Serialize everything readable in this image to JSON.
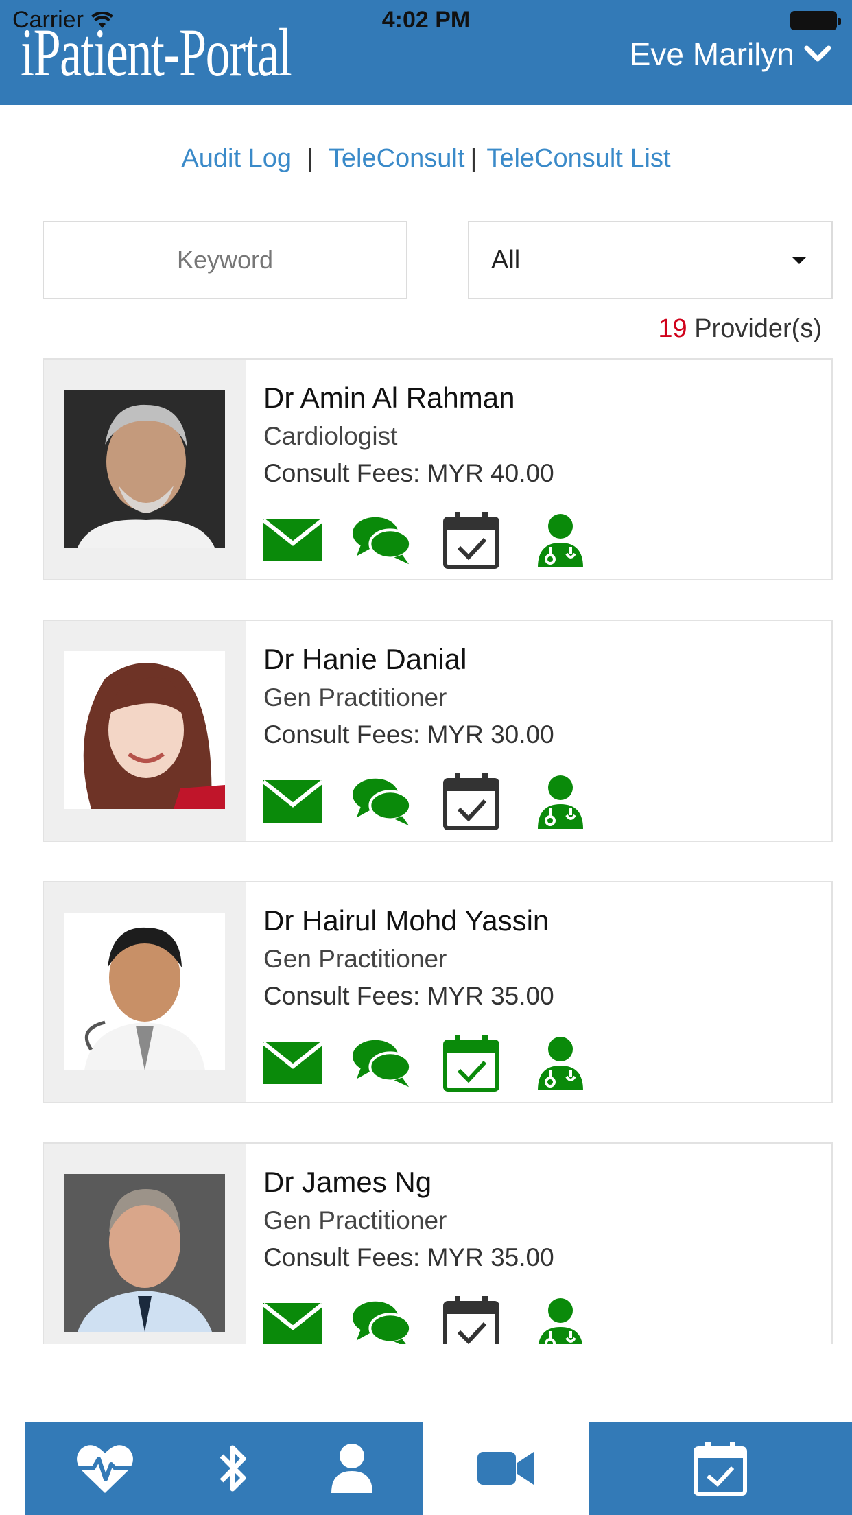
{
  "status_bar": {
    "carrier": "Carrier",
    "time": "4:02 PM"
  },
  "header": {
    "logo": "iPatient-Portal",
    "user_name": "Eve Marilyn"
  },
  "links": [
    {
      "label": "Audit Log"
    },
    {
      "label": "TeleConsult"
    },
    {
      "label": "TeleConsult List"
    }
  ],
  "search": {
    "placeholder": "Keyword"
  },
  "filter": {
    "selected": "All"
  },
  "provider_count": {
    "number": "19",
    "label": "Provider(s)"
  },
  "providers": [
    {
      "name": "Dr Amin Al Rahman",
      "specialty": "Cardiologist",
      "fee_label": "Consult Fees:",
      "fee": "MYR 40.00",
      "calendar_color": "#333333"
    },
    {
      "name": "Dr Hanie Danial",
      "specialty": "Gen Practitioner",
      "fee_label": "Consult Fees:",
      "fee": "MYR 30.00",
      "calendar_color": "#333333"
    },
    {
      "name": "Dr Hairul Mohd Yassin",
      "specialty": "Gen Practitioner",
      "fee_label": "Consult Fees:",
      "fee": "MYR 35.00",
      "calendar_color": "#0a8a0a"
    },
    {
      "name": "Dr James Ng",
      "specialty": "Gen Practitioner",
      "fee_label": "Consult Fees:",
      "fee": "MYR 35.00",
      "calendar_color": "#333333"
    }
  ],
  "bottom_nav": [
    {
      "icon": "heartbeat-icon"
    },
    {
      "icon": "bluetooth-icon"
    },
    {
      "icon": "user-icon"
    },
    {
      "icon": "video-camera-icon",
      "active": true
    },
    {
      "icon": "calendar-check-icon"
    }
  ],
  "colors": {
    "brand_blue": "#337ab7",
    "link_blue": "#3a8ac9",
    "action_green": "#0a8a0a",
    "count_red": "#d0021b"
  }
}
